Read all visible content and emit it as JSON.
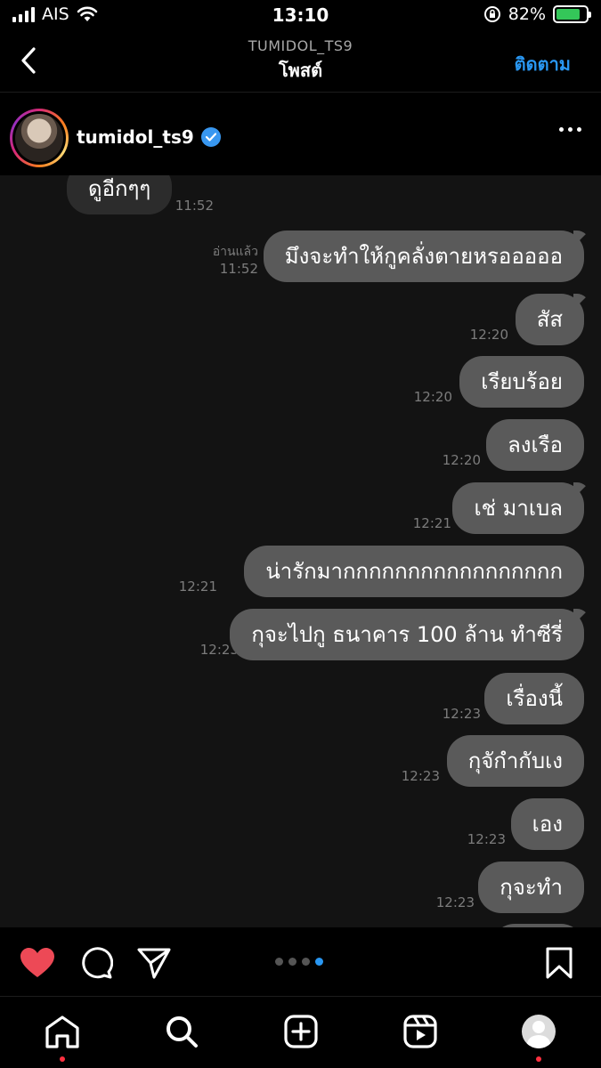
{
  "status_bar": {
    "carrier": "AIS",
    "time": "13:10",
    "battery_percent": "82%",
    "battery_level": 0.82
  },
  "nav": {
    "subtitle": "TUMIDOL_TS9",
    "title": "โพสต์",
    "follow_label": "ติดตาม"
  },
  "post": {
    "username": "tumidol_ts9",
    "verified": true
  },
  "chat": {
    "read_receipt": "อ่านแล้ว",
    "messages": [
      {
        "text": "ดูอีกๆๆ",
        "time": "11:52",
        "from": "them"
      },
      {
        "text": "มึงจะทำให้กูคลั่งตายหรอออออ",
        "time": "11:52",
        "from": "me"
      },
      {
        "text": "สัส",
        "time": "12:20",
        "from": "me"
      },
      {
        "text": "เรียบร้อย",
        "time": "12:20",
        "from": "me"
      },
      {
        "text": "ลงเรือ",
        "time": "12:20",
        "from": "me"
      },
      {
        "text": "เช่ มาเบล",
        "time": "12:21",
        "from": "me"
      },
      {
        "text": "น่ารักมากกกกกกกกกกกกกกกกก",
        "time": "12:21",
        "from": "me"
      },
      {
        "text": "กุจะไปกู ธนาคาร 100 ล้าน ทำซีรี่",
        "time": "12:23",
        "from": "me"
      },
      {
        "text": "เรื่องนี้",
        "time": "12:23",
        "from": "me"
      },
      {
        "text": "กุจักำกับเง",
        "time": "12:23",
        "from": "me"
      },
      {
        "text": "เอง",
        "time": "12:23",
        "from": "me"
      },
      {
        "text": "กุจะทำ",
        "time": "12:23",
        "from": "me"
      }
    ]
  },
  "carousel": {
    "count": 4,
    "active_index": 3
  },
  "colors": {
    "accent": "#2997f2",
    "like": "#ed4956",
    "bubble_me": "#5a5a5a",
    "bubble_them": "#2c2c2c"
  },
  "icons": {
    "actions": [
      "heart-icon",
      "comment-icon",
      "share-icon",
      "bookmark-icon"
    ],
    "tabs": [
      "home-icon",
      "search-icon",
      "create-icon",
      "reels-icon",
      "profile-icon"
    ]
  }
}
